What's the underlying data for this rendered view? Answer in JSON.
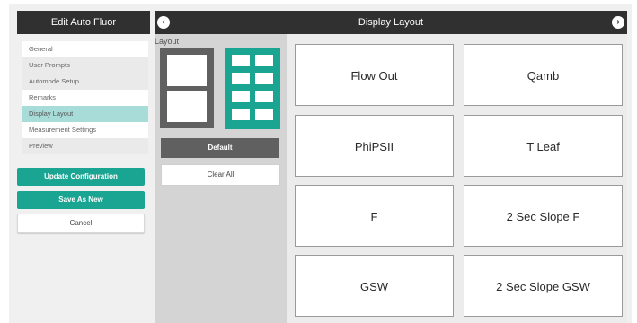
{
  "left_panel": {
    "title": "Edit Auto Fluor",
    "nav_items": [
      {
        "label": "General"
      },
      {
        "label": "User Prompts"
      },
      {
        "label": "Automode Setup"
      },
      {
        "label": "Remarks"
      },
      {
        "label": "Display Layout",
        "active": true
      },
      {
        "label": "Measurement Settings"
      },
      {
        "label": "Preview"
      }
    ],
    "update_button": "Update Configuration",
    "save_as_new_button": "Save As New",
    "cancel_button": "Cancel"
  },
  "main": {
    "title": "Display Layout",
    "layout_label": "Layout",
    "default_button": "Default",
    "clear_all_button": "Clear All",
    "tiles": [
      "Flow Out",
      "Qamb",
      "PhiPSII",
      "T Leaf",
      "F",
      "2 Sec Slope F",
      "GSW",
      "2 Sec Slope GSW"
    ]
  },
  "icons": {
    "prev": "chevron-left-icon",
    "next": "chevron-right-icon"
  },
  "colors": {
    "header": "#303030",
    "accent": "#1aa592",
    "active_nav": "#a8dcd8",
    "layout_thumb_gray": "#606060"
  }
}
